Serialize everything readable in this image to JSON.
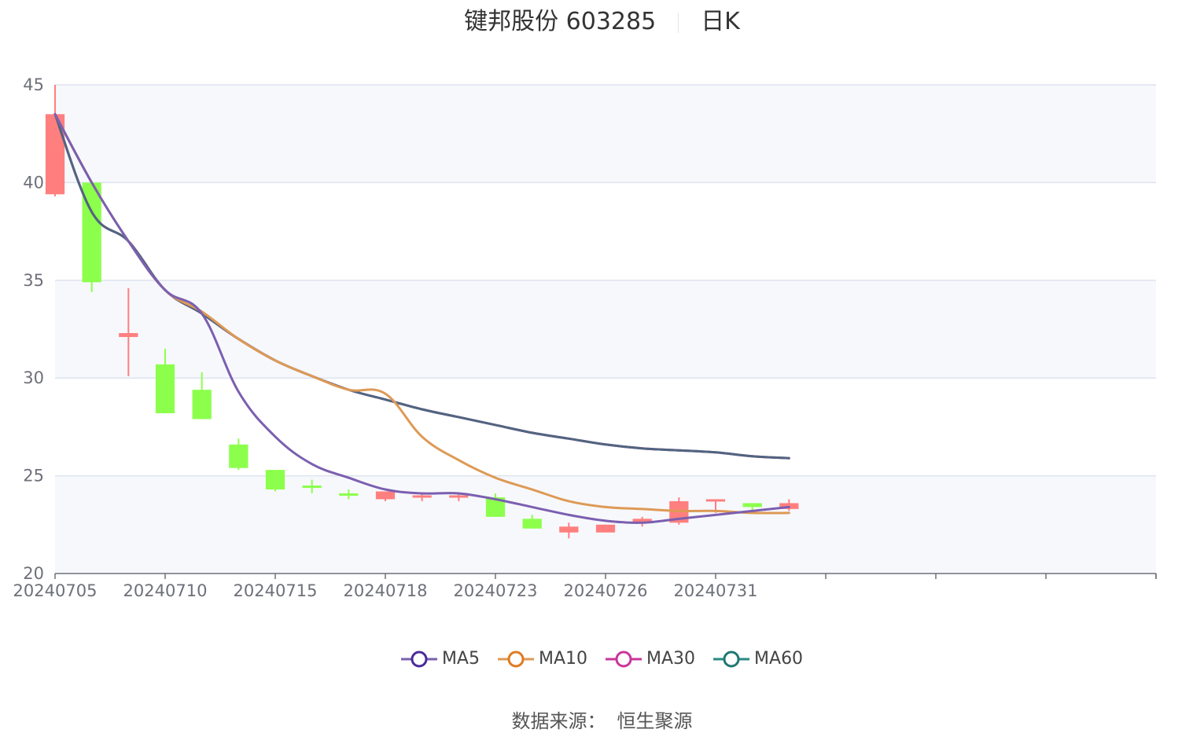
{
  "title": {
    "name": "键邦股份 603285",
    "period": "日K"
  },
  "source": {
    "label": "数据来源：",
    "value": "恒生聚源"
  },
  "colors": {
    "up": "#ff7f7f",
    "down": "#8cff4c",
    "MA5": "#7b5fb0",
    "MA10": "#dd9a55",
    "MA30": "#c9359a",
    "MA60": "#4f6580",
    "grid": "#dde3ef",
    "band": "#f7f8fc",
    "axis": "#6e7079"
  },
  "chart_data": {
    "type": "candlestick",
    "ylim": [
      20,
      45
    ],
    "yticks": [
      20,
      25,
      30,
      35,
      40,
      45
    ],
    "x_tick_labels": [
      {
        "index": 0,
        "label": "20240705"
      },
      {
        "index": 3,
        "label": "20240710"
      },
      {
        "index": 6,
        "label": "20240715"
      },
      {
        "index": 9,
        "label": "20240718"
      },
      {
        "index": 12,
        "label": "20240723"
      },
      {
        "index": 15,
        "label": "20240726"
      },
      {
        "index": 18,
        "label": "20240731"
      }
    ],
    "x_axis_slots": 30,
    "candles": [
      {
        "o": 39.4,
        "c": 43.5,
        "h": 45.0,
        "l": 39.3
      },
      {
        "o": 40.0,
        "c": 34.9,
        "h": 40.0,
        "l": 34.4
      },
      {
        "o": 32.1,
        "c": 32.3,
        "h": 34.6,
        "l": 30.1
      },
      {
        "o": 30.7,
        "c": 28.2,
        "h": 31.5,
        "l": 28.2
      },
      {
        "o": 29.4,
        "c": 27.9,
        "h": 30.3,
        "l": 27.9
      },
      {
        "o": 26.6,
        "c": 25.4,
        "h": 26.9,
        "l": 25.3
      },
      {
        "o": 25.3,
        "c": 24.3,
        "h": 25.3,
        "l": 24.2
      },
      {
        "o": 24.5,
        "c": 24.4,
        "h": 24.8,
        "l": 24.1
      },
      {
        "o": 24.1,
        "c": 24.0,
        "h": 24.3,
        "l": 23.8
      },
      {
        "o": 23.8,
        "c": 24.2,
        "h": 24.2,
        "l": 23.7
      },
      {
        "o": 23.9,
        "c": 24.0,
        "h": 24.1,
        "l": 23.7
      },
      {
        "o": 23.9,
        "c": 24.0,
        "h": 24.1,
        "l": 23.7
      },
      {
        "o": 23.9,
        "c": 22.9,
        "h": 24.1,
        "l": 22.9
      },
      {
        "o": 22.8,
        "c": 22.3,
        "h": 23.0,
        "l": 22.3
      },
      {
        "o": 22.1,
        "c": 22.4,
        "h": 22.6,
        "l": 21.8
      },
      {
        "o": 22.1,
        "c": 22.5,
        "h": 22.5,
        "l": 22.1
      },
      {
        "o": 22.6,
        "c": 22.8,
        "h": 22.9,
        "l": 22.4
      },
      {
        "o": 22.6,
        "c": 23.7,
        "h": 23.9,
        "l": 22.5
      },
      {
        "o": 23.7,
        "c": 23.8,
        "h": 23.8,
        "l": 23.1
      },
      {
        "o": 23.6,
        "c": 23.4,
        "h": 23.6,
        "l": 23.2
      },
      {
        "o": 23.3,
        "c": 23.6,
        "h": 23.8,
        "l": 23.2
      }
    ],
    "series": [
      {
        "name": "MA5",
        "values": [
          43.5,
          40.0,
          37.0,
          34.5,
          33.3,
          29.3,
          27.0,
          25.6,
          24.9,
          24.3,
          24.1,
          24.1,
          23.8,
          23.4,
          23.0,
          22.7,
          22.6,
          22.8,
          23.0,
          23.2,
          23.4
        ]
      },
      {
        "name": "MA10",
        "values": [
          43.5,
          40.0,
          37.0,
          34.5,
          33.4,
          32.0,
          30.9,
          30.1,
          29.4,
          29.2,
          27.0,
          25.8,
          24.9,
          24.3,
          23.7,
          23.4,
          23.3,
          23.2,
          23.2,
          23.1,
          23.1
        ]
      },
      {
        "name": "MA30",
        "values": [
          43.5,
          38.5,
          37.0,
          34.5,
          33.3,
          32.0,
          30.9,
          30.1,
          29.4,
          28.9,
          28.4,
          28.0,
          27.6,
          27.2,
          26.9,
          26.6,
          26.4,
          26.3,
          26.2,
          26.0,
          25.9
        ]
      },
      {
        "name": "MA60",
        "values": [
          43.5,
          38.5,
          37.0,
          34.5,
          33.3,
          32.0,
          30.9,
          30.1,
          29.4,
          28.9,
          28.4,
          28.0,
          27.6,
          27.2,
          26.9,
          26.6,
          26.4,
          26.3,
          26.2,
          26.0,
          25.9
        ]
      }
    ],
    "legend_position": "bottom",
    "grid": true
  }
}
